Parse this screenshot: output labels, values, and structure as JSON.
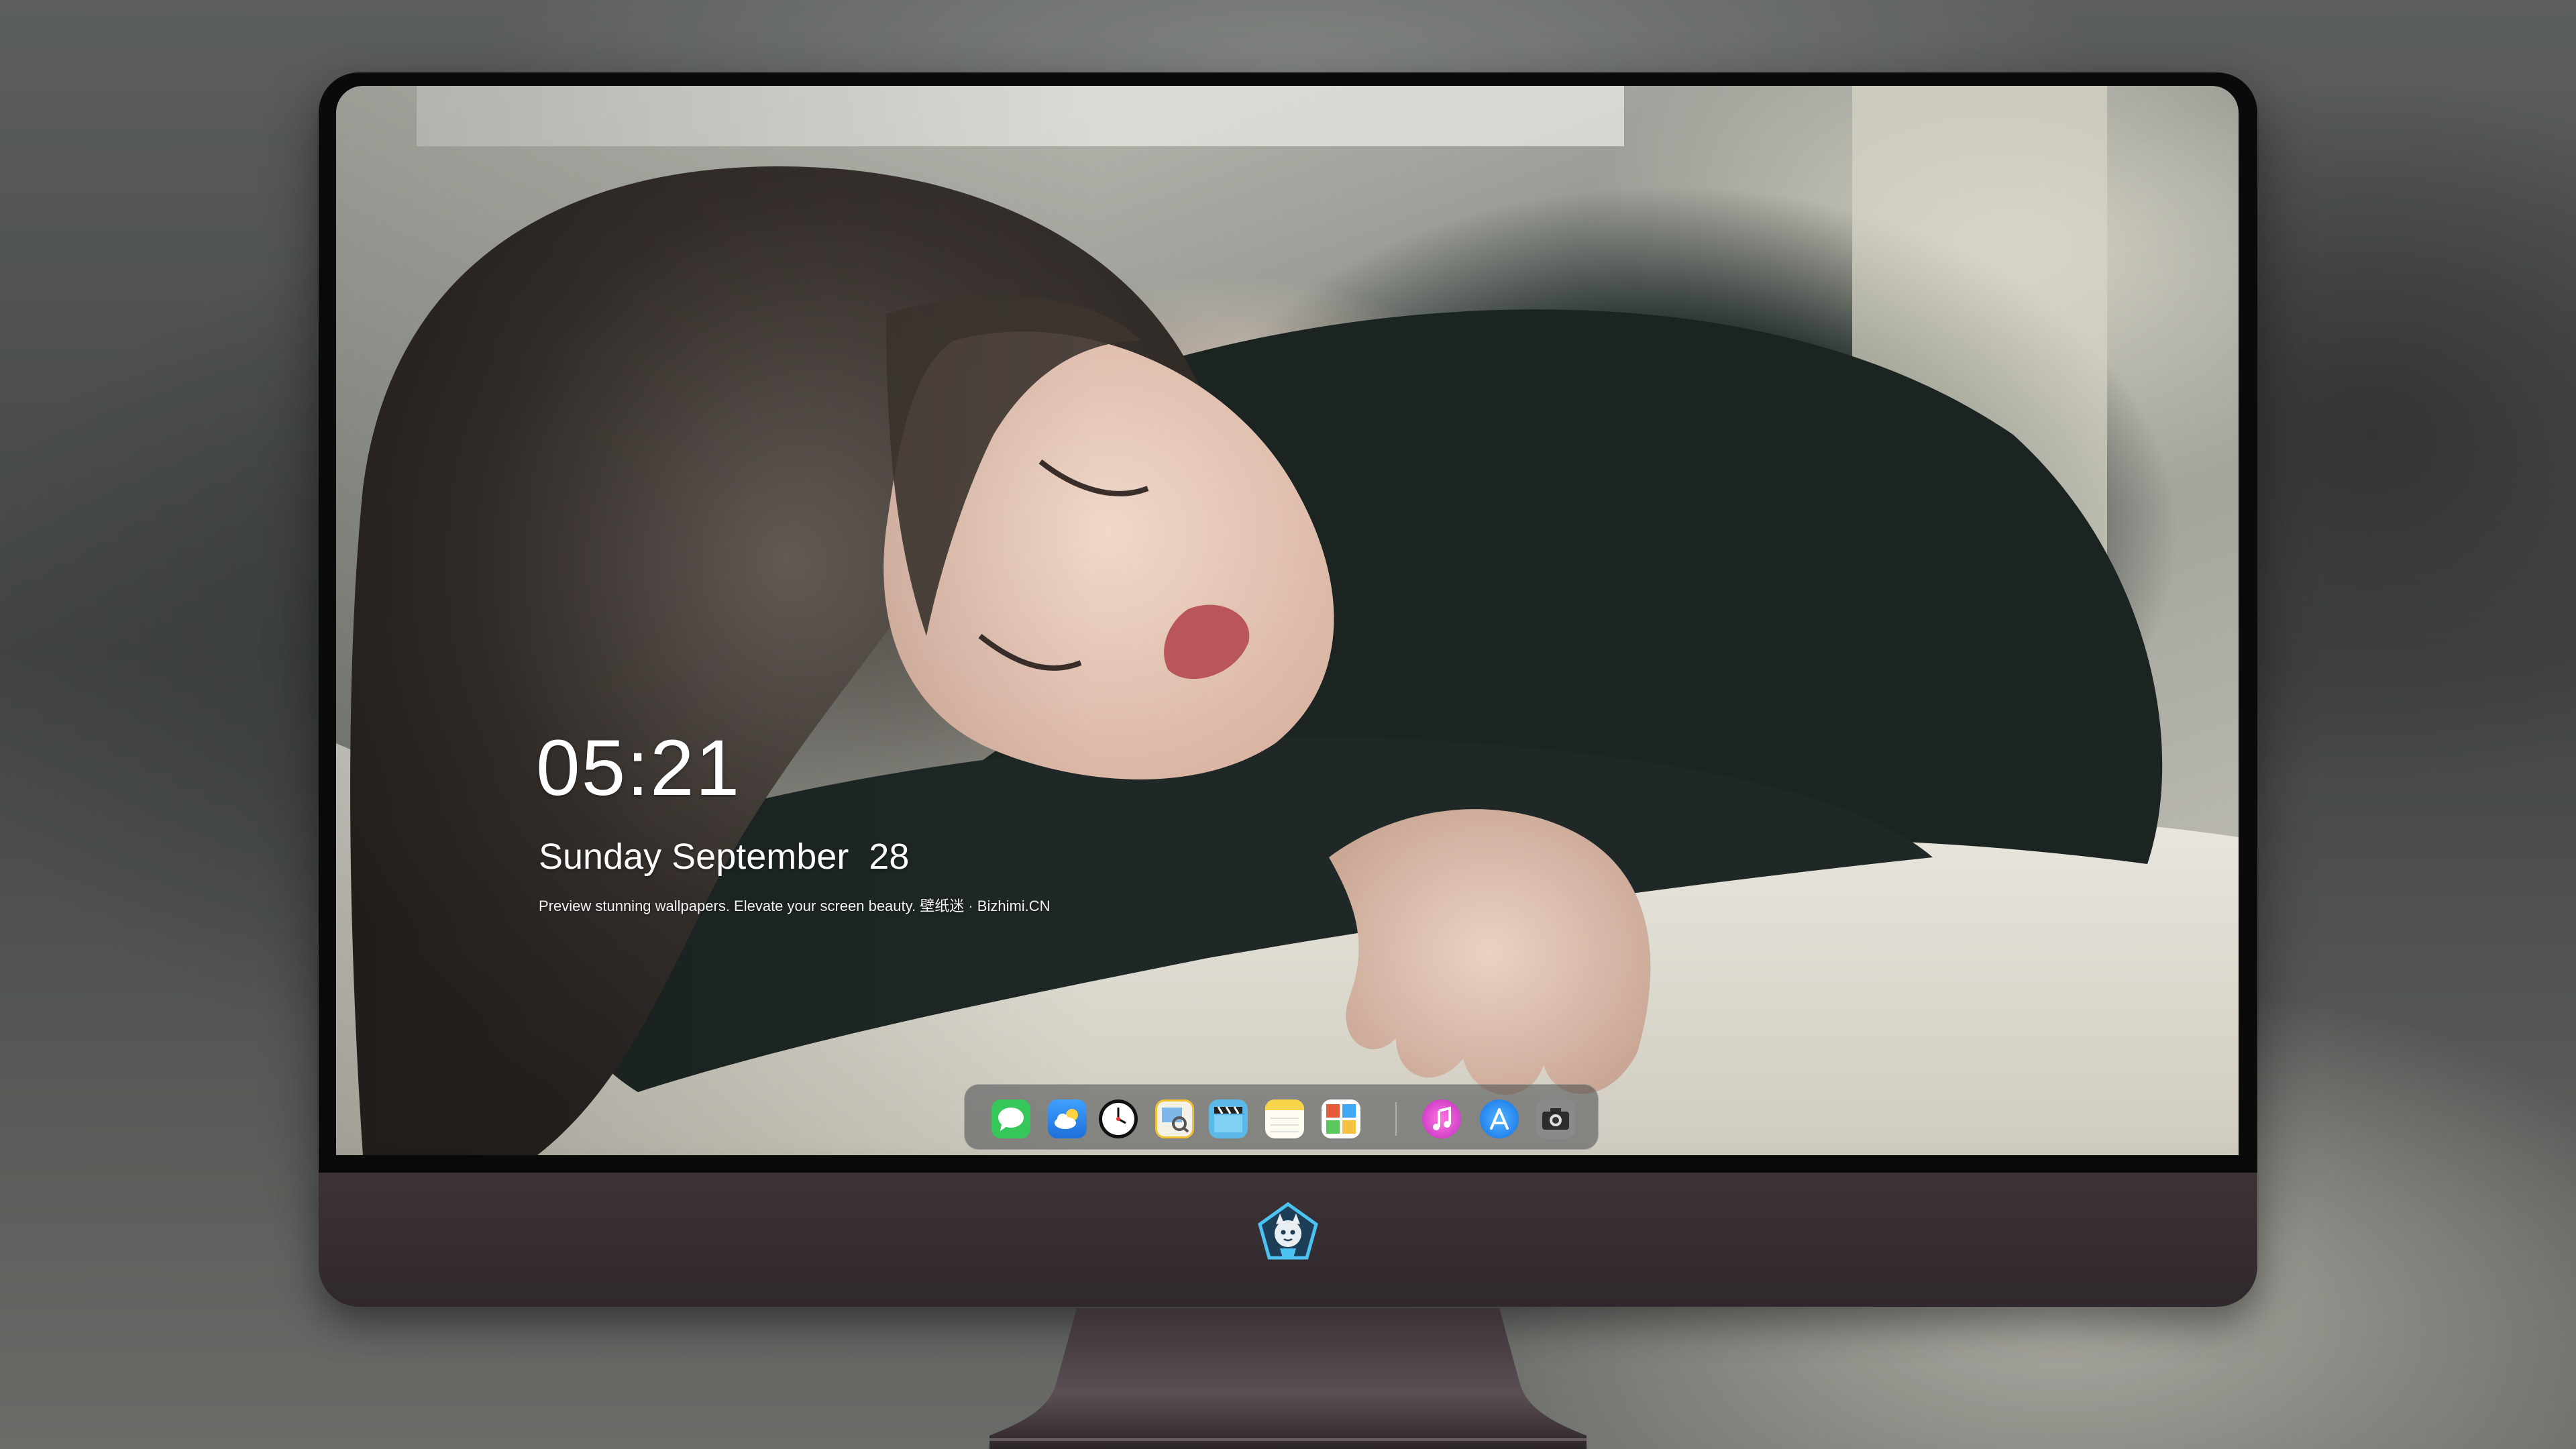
{
  "lock_screen": {
    "time": "05:21",
    "date": "Sunday September  28",
    "tagline": "Preview stunning wallpapers. Elevate your screen beauty. 壁纸迷 · Bizhimi.CN"
  },
  "dock": {
    "apps": [
      {
        "name": "Messages",
        "icon": "messages-icon",
        "color": "#35c75a"
      },
      {
        "name": "Weather",
        "icon": "weather-icon",
        "color": "#2f8cf2"
      },
      {
        "name": "Clock",
        "icon": "clock-icon",
        "color": "#111111"
      },
      {
        "name": "Preview",
        "icon": "preview-icon",
        "color": "#f2c232"
      },
      {
        "name": "Clips",
        "icon": "clapperboard-icon",
        "color": "#5bb8e8"
      },
      {
        "name": "Notes",
        "icon": "notes-icon",
        "color": "#f7d54a"
      },
      {
        "name": "Photo Booth",
        "icon": "photo-booth-icon",
        "color": "#e65a3c"
      },
      {
        "name": "iTunes",
        "icon": "music-icon",
        "color": "#ee3fd0"
      },
      {
        "name": "App Store",
        "icon": "app-store-icon",
        "color": "#1a8cff"
      },
      {
        "name": "Camera",
        "icon": "camera-icon",
        "color": "#7a7a7a"
      }
    ]
  },
  "device": {
    "chin_logo": "mascot-logo-icon",
    "chin_color": "#3d3337"
  }
}
